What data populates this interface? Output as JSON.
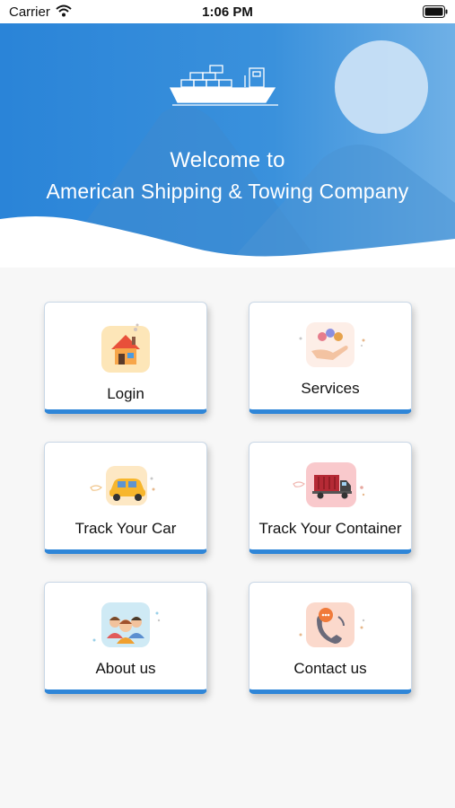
{
  "status_bar": {
    "carrier": "Carrier",
    "time": "1:06 PM"
  },
  "header": {
    "welcome": "Welcome to",
    "company": "American Shipping & Towing Company",
    "colors": {
      "primary": "#2f86d8",
      "light": "#7eb6e8"
    },
    "icon": "ship-icon"
  },
  "menu": {
    "items": [
      {
        "label": "Login",
        "icon": "house-icon"
      },
      {
        "label": "Services",
        "icon": "services-hands-icon"
      },
      {
        "label": "Track Your Car",
        "icon": "car-icon"
      },
      {
        "label": "Track Your Container",
        "icon": "truck-icon"
      },
      {
        "label": "About us",
        "icon": "people-icon"
      },
      {
        "label": "Contact us",
        "icon": "phone-icon"
      }
    ]
  }
}
